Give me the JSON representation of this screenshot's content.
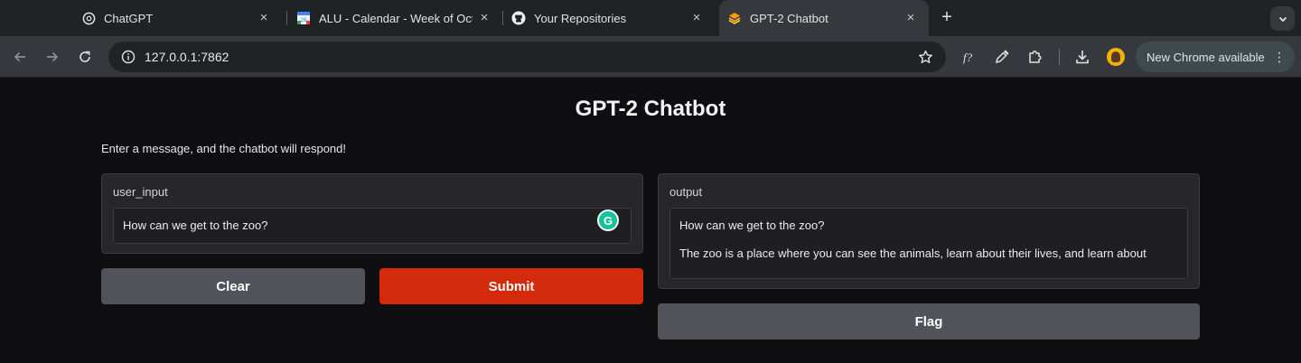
{
  "browser": {
    "tabs": [
      {
        "title": "ChatGPT",
        "icon": "chatgpt-icon",
        "active": false
      },
      {
        "title": "ALU - Calendar - Week of Oct",
        "icon": "calendar-icon",
        "active": false
      },
      {
        "title": "Your Repositories",
        "icon": "github-icon",
        "active": false
      },
      {
        "title": "GPT-2 Chatbot",
        "icon": "gradio-icon",
        "active": true
      }
    ],
    "tab_close_symbol": "×",
    "new_tab_symbol": "+",
    "tab_search_symbol": "⌄",
    "calendar_day": "28",
    "url": "127.0.0.1:7862",
    "update_label": "New Chrome available",
    "menu_symbol": "⋮"
  },
  "app": {
    "title": "GPT-2 Chatbot",
    "description": "Enter a message, and the chatbot will respond!",
    "input": {
      "label": "user_input",
      "value": "How can we get to the zoo?"
    },
    "output": {
      "label": "output",
      "line1": "How can we get to the zoo?",
      "line2": "The zoo is a place where you can see the animals, learn about their lives, and learn about"
    },
    "buttons": {
      "clear": "Clear",
      "submit": "Submit",
      "flag": "Flag"
    },
    "grammarly_letter": "G"
  },
  "colors": {
    "primary": "#d22a0a",
    "secondary": "#52525b",
    "background": "#0f0f11",
    "panel": "#27272a"
  }
}
